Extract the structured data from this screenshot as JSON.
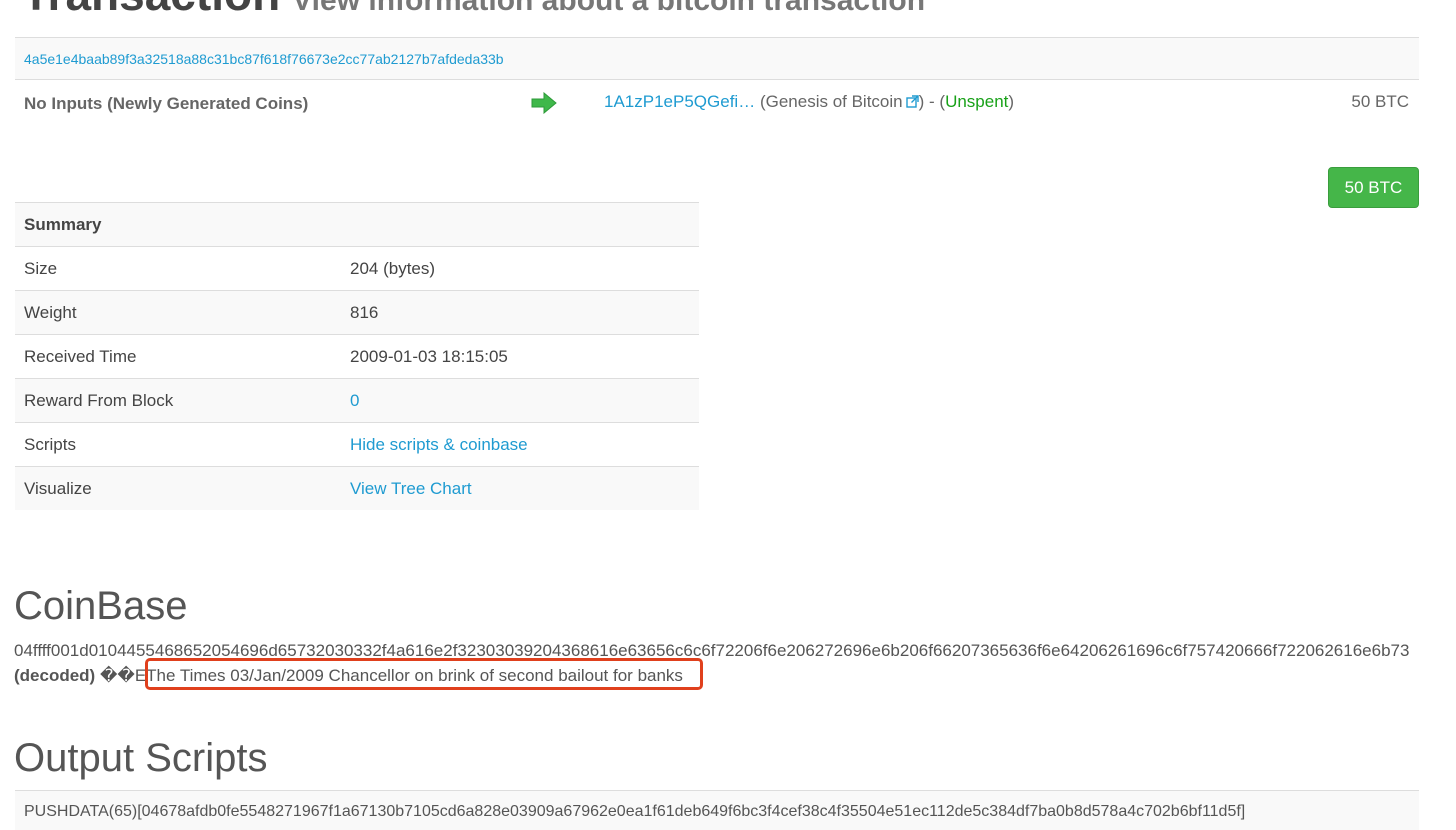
{
  "header": {
    "title": "Transaction",
    "subtitle": "View information about a bitcoin transaction"
  },
  "transaction": {
    "hash": "4a5e1e4baab89f3a32518a88c31bc87f618f76673e2cc77ab2127b7afdeda33b",
    "inputs_label": "No Inputs (Newly Generated Coins)",
    "output_address": "1A1zP1eP5QGefi…",
    "output_open": "(",
    "output_tag": "Genesis of Bitcoin",
    "output_sep": ") - (",
    "output_status": "Unspent",
    "output_close": ")",
    "output_amount": "50 BTC",
    "total_amount": "50 BTC"
  },
  "summary": {
    "heading": "Summary",
    "rows": [
      {
        "label": "Size",
        "value": "204 (bytes)"
      },
      {
        "label": "Weight",
        "value": "816"
      },
      {
        "label": "Received Time",
        "value": "2009-01-03 18:15:05"
      },
      {
        "label": "Reward From Block",
        "value": "0"
      },
      {
        "label": "Scripts",
        "value": "Hide scripts & coinbase"
      },
      {
        "label": "Visualize",
        "value": "View Tree Chart"
      }
    ]
  },
  "coinbase": {
    "heading": "CoinBase",
    "hex": "04ffff001d0104455468652054696d65732030332f4a616e2f32303039204368616e63656c6c6f72206f6e206272696e6b206f66207365636f6e64206261696c6f757420666f722062616e6b73",
    "decoded_label": "(decoded)",
    "decoded_prefix": "��E",
    "decoded_message": "The Times 03/Jan/2009 Chancellor on brink of second bailout for banks"
  },
  "output_scripts": {
    "heading": "Output Scripts",
    "script": "PUSHDATA(65)[04678afdb0fe5548271967f1a67130b7105cd6a828e03909a67962e0ea1f61deb649f6bc3f4cef38c4f35504e51ec112de5c384df7ba0b8d578a4c702b6bf11d5f]"
  },
  "colors": {
    "link": "#1f9bd1",
    "unspent": "#18a118",
    "button": "#45b649",
    "highlight": "#e0401d"
  }
}
